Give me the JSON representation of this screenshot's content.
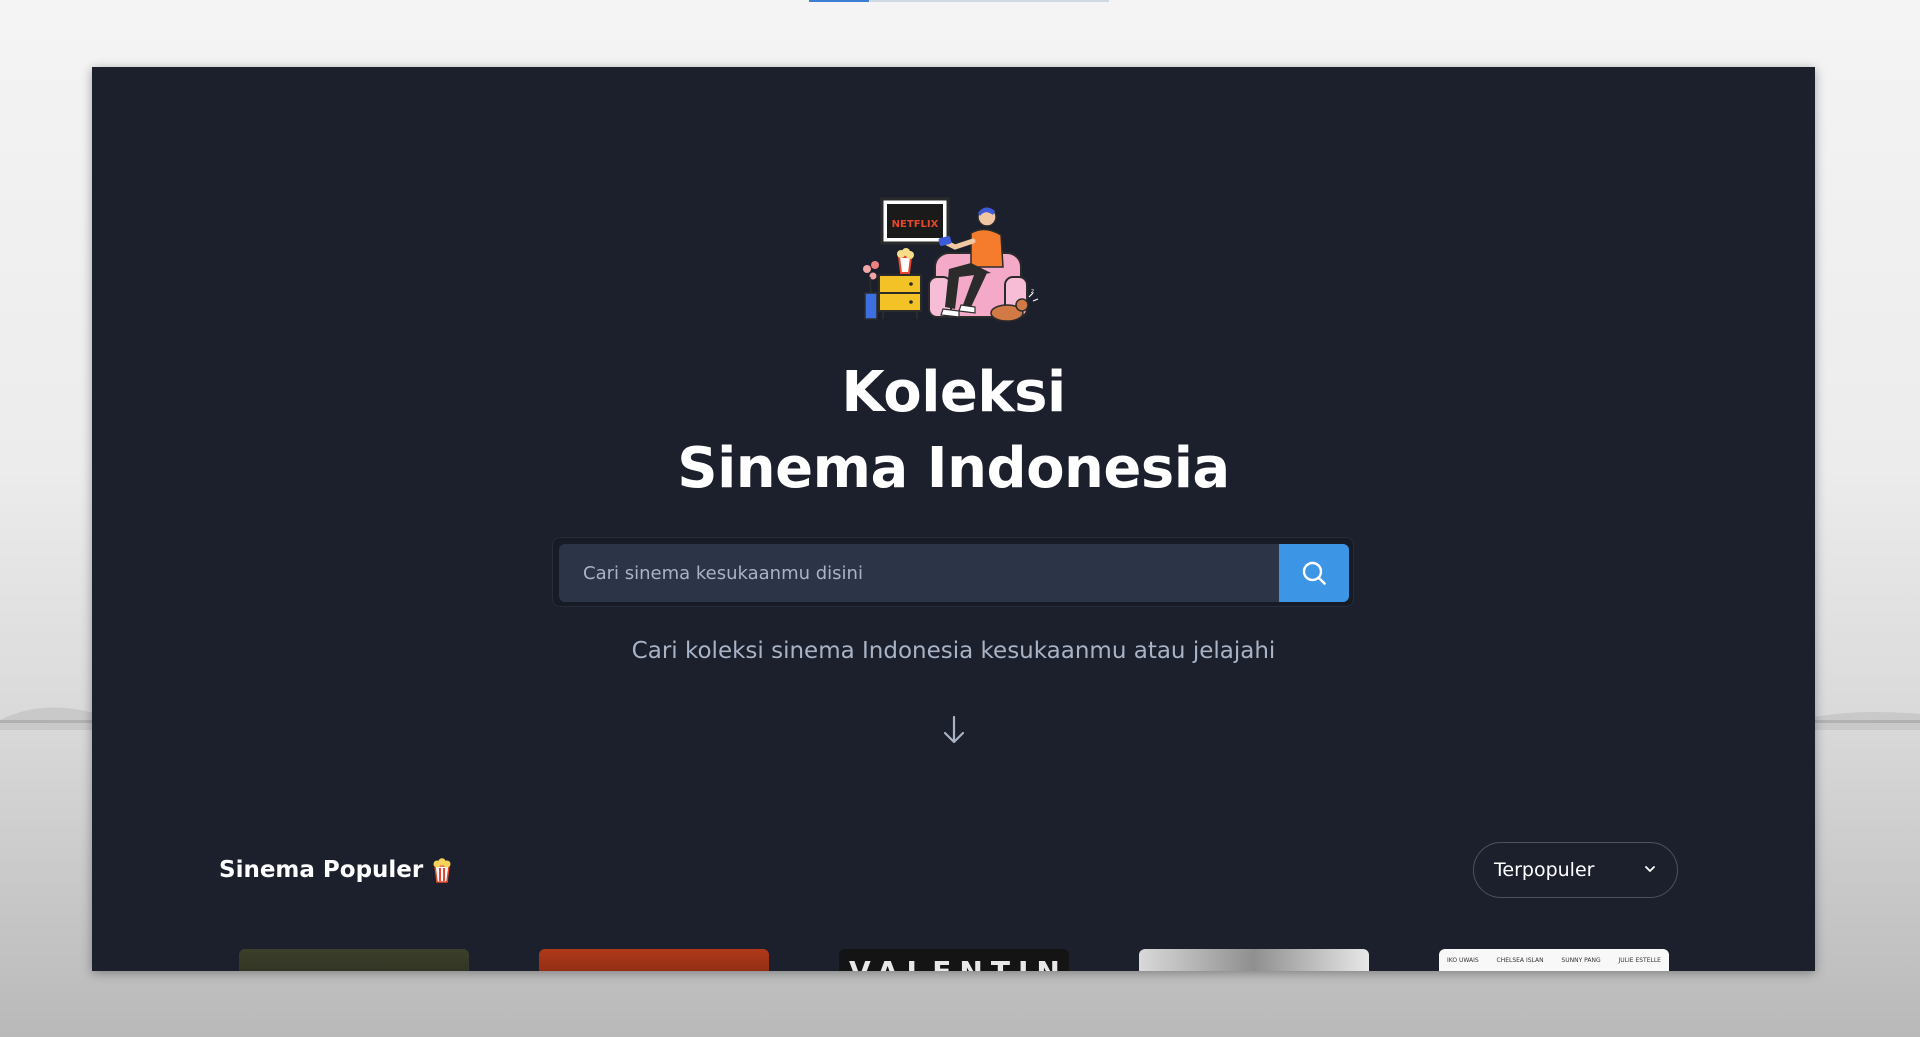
{
  "page": {
    "load_progress": 0.2
  },
  "hero": {
    "illustration_sign": "NETFLIX",
    "title_line1": "Koleksi",
    "title_line2": "Sinema Indonesia",
    "subtitle": "Cari koleksi sinema Indonesia kesukaanmu atau jelajahi"
  },
  "search": {
    "placeholder": "Cari sinema kesukaanmu disini",
    "value": "",
    "button_icon": "search-icon"
  },
  "section": {
    "title": "Sinema Populer",
    "title_icon": "popcorn-icon"
  },
  "sort": {
    "selected": "Terpopuler",
    "icon": "chevron-down-icon"
  },
  "posters": [
    {
      "text": ""
    },
    {
      "text": ""
    },
    {
      "text": "VALENTINE"
    },
    {
      "text": ""
    },
    {
      "credits": [
        "IKO UWAIS",
        "CHELSEA ISLAN",
        "SUNNY PANG",
        "JULIE ESTELLE"
      ]
    }
  ],
  "colors": {
    "app_background": "#1b202c",
    "search_field": "#2c3447",
    "accent": "#3d95e6",
    "subtitle_text": "#a9b3c6"
  }
}
